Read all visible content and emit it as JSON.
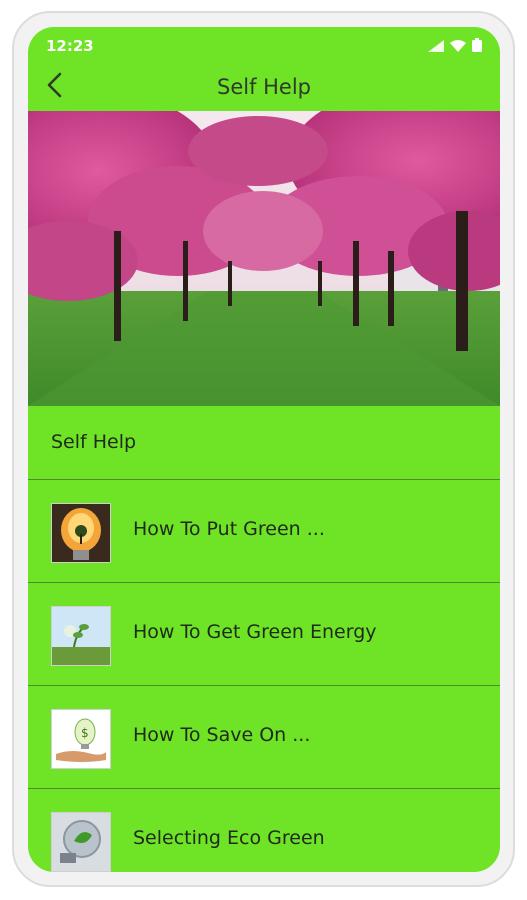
{
  "status": {
    "time": "12:23",
    "icons": [
      "signal-icon",
      "wifi-icon",
      "battery-icon"
    ]
  },
  "app_bar": {
    "title": "Self Help",
    "back_icon": "chevron-left-icon"
  },
  "hero": {
    "image": "cherry-blossom-avenue-image"
  },
  "section": {
    "title": "Self Help"
  },
  "list": {
    "items": [
      {
        "label": "How To Put Green ...",
        "icon": "lightbulb-tree-thumbnail"
      },
      {
        "label": "How To Get Green Energy",
        "icon": "sprout-field-thumbnail"
      },
      {
        "label": "How To Save On ...",
        "icon": "money-bulb-hand-thumbnail"
      },
      {
        "label": "Selecting Eco Green",
        "icon": "eco-bulb-thumbnail"
      }
    ]
  },
  "colors": {
    "accent": "#6fe325",
    "divider": "#4f8a2b",
    "text": "#1f2a1c"
  }
}
